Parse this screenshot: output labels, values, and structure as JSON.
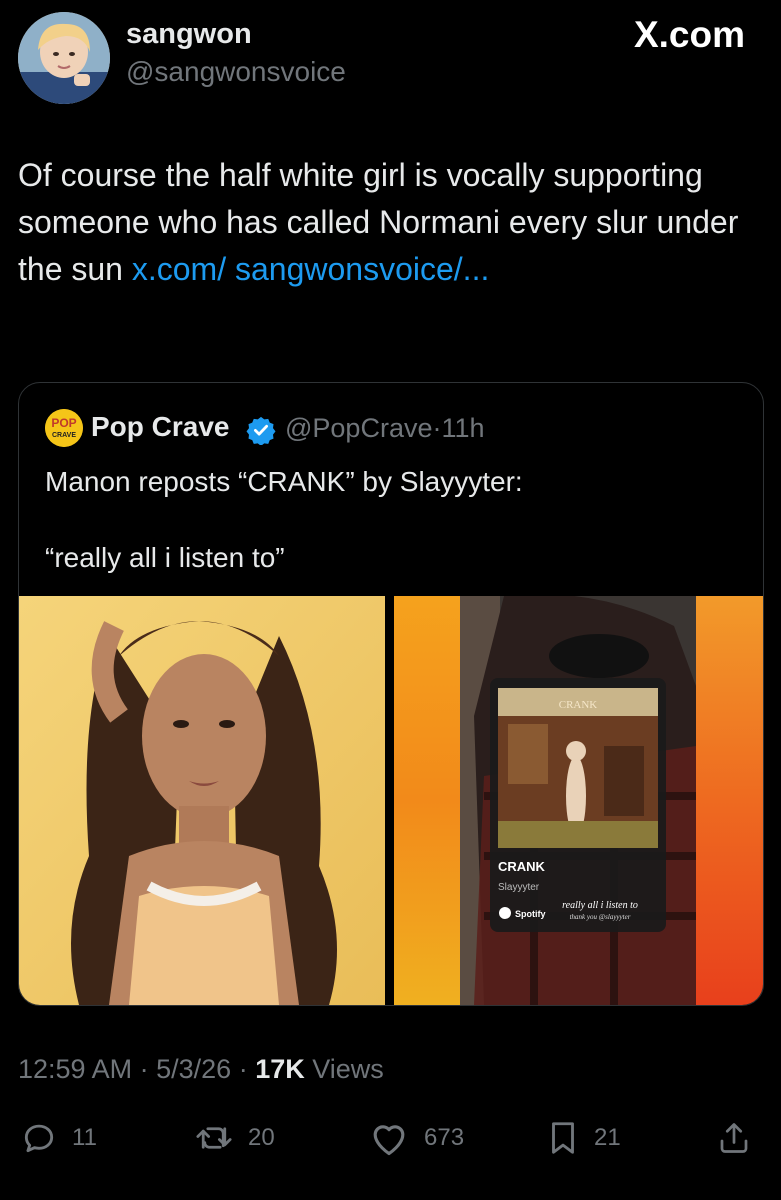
{
  "author": {
    "display_name": "sangwon",
    "handle": "@sangwonsvoice"
  },
  "brand": {
    "logo_text": "X.com"
  },
  "tweet": {
    "text": "Of course the half white girl is vocally supporting someone who has called Normani every slur under the sun ",
    "link_text": "x.com/ sangwonsvoice/..."
  },
  "quoted": {
    "display_name": "Pop Crave",
    "handle": "@PopCrave",
    "separator": "·",
    "time": "11h",
    "logo_text_top": "POP",
    "logo_text_bottom": "CRAVE",
    "text": "Manon reposts “CRANK” by Slayyyter:\n\n“really all i listen to”",
    "media": {
      "left_description": "portrait photo",
      "right_card": {
        "album_title": "CRANK",
        "title": "CRANK",
        "artist": "Slayyyter",
        "service": "Spotify",
        "note": "really all i listen to",
        "note_sub": "thank you @slayyyter"
      }
    }
  },
  "meta": {
    "time": "12:59 AM",
    "sep1": "·",
    "date": "5/3/26",
    "sep2": "·",
    "views_count": "17K",
    "views_label": "Views"
  },
  "actions": {
    "replies": "11",
    "reposts": "20",
    "likes": "673",
    "bookmarks": "21"
  },
  "colors": {
    "background": "#000000",
    "text": "#e7e9ea",
    "secondary": "#71767b",
    "link": "#1d9bf0",
    "border": "#2f3336"
  }
}
